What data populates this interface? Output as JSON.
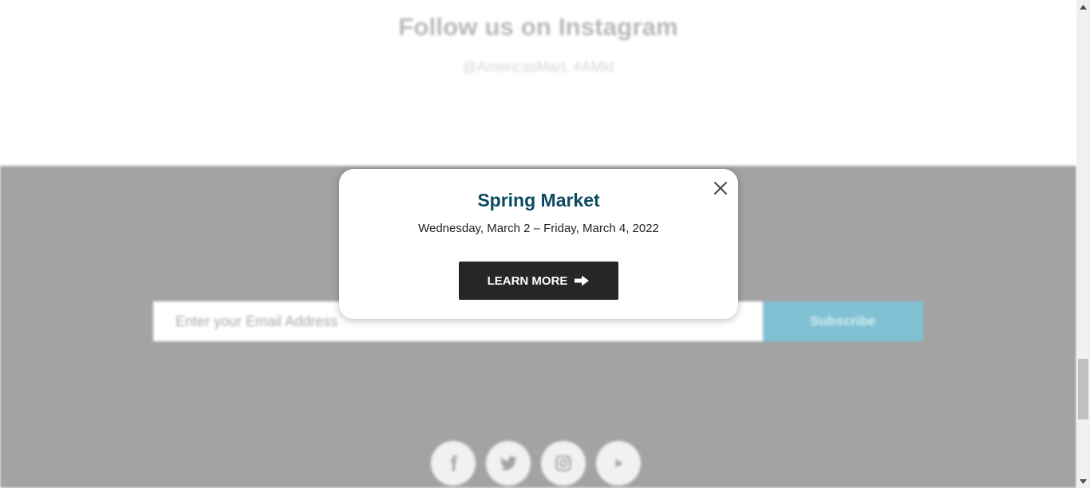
{
  "background": {
    "instagram": {
      "title": "Follow us on Instagram",
      "handle": "@AmericasMart, #AMkt"
    },
    "newsletter": {
      "email_placeholder": "Enter your Email Address",
      "subscribe_label": "Subscribe"
    },
    "socials": [
      {
        "icon": "facebook-icon"
      },
      {
        "icon": "twitter-icon"
      },
      {
        "icon": "instagram-icon"
      },
      {
        "icon": "youtube-icon"
      }
    ]
  },
  "modal": {
    "title": "Spring Market",
    "date": "Wednesday, March 2 – Friday, March 4, 2022",
    "button_label": "LEARN MORE",
    "button_icon": "arrow-right-icon",
    "close_icon": "close-icon"
  },
  "colors": {
    "title": "#0c4a61",
    "button_bg": "#262626",
    "footer_bg": "#a3a3a3",
    "subscribe_bg": "#80c1d3"
  }
}
